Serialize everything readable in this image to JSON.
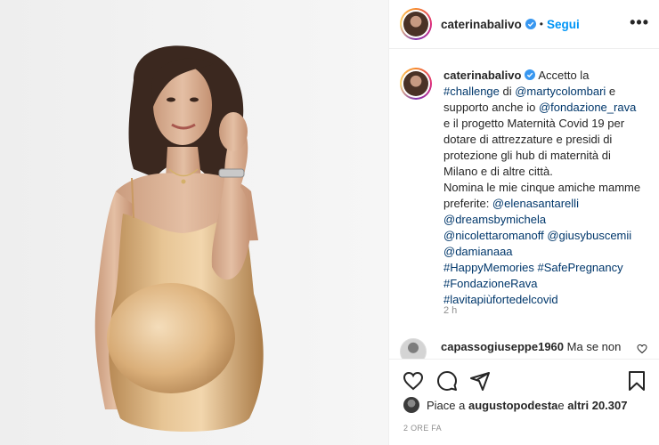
{
  "post": {
    "username": "caterinabalivo",
    "follow_label": "Segui",
    "dot": "•",
    "more_label": "•••"
  },
  "caption": {
    "username": "caterinabalivo",
    "lines": [
      [
        "Accetto la"
      ],
      [
        "#challenge",
        " di ",
        "@martycolombari",
        " e"
      ],
      [
        "supporto anche io ",
        "@fondazione_rava"
      ],
      [
        "e il progetto Maternità Covid 19 per"
      ],
      [
        "dotare di attrezzature e presidi di"
      ],
      [
        "protezione gli hub di maternità di"
      ],
      [
        "Milano e di altre città."
      ],
      [
        "Nomina le mie cinque amiche mamme"
      ],
      [
        "preferite: ",
        "@elenasantarelli"
      ],
      [
        "@dreamsbymichela"
      ],
      [
        "@nicolettaromanoff",
        " ",
        "@giusybuscemii"
      ],
      [
        "@damianaaa"
      ],
      [
        "#HappyMemories",
        " ",
        "#SafePregnancy"
      ],
      [
        "#FondazioneRava"
      ],
      [
        "#lavitapiùfortedelcovid"
      ]
    ],
    "time_relative": "2 h"
  },
  "comment": {
    "username": "capassogiuseppe1960",
    "text": "Ma se non"
  },
  "likes": {
    "prefix": "Piace a ",
    "user": "augustopodesta",
    "middle": " e ",
    "others": "altri 20.307"
  },
  "time_absolute": "2 ORE FA",
  "colors": {
    "link": "#00376b",
    "follow": "#0095f6",
    "verified": "#3897f0",
    "dress": "#d9b07a"
  },
  "icons": [
    "verified-badge-icon",
    "more-options-icon",
    "heart-icon",
    "comment-icon",
    "share-icon",
    "bookmark-icon"
  ]
}
